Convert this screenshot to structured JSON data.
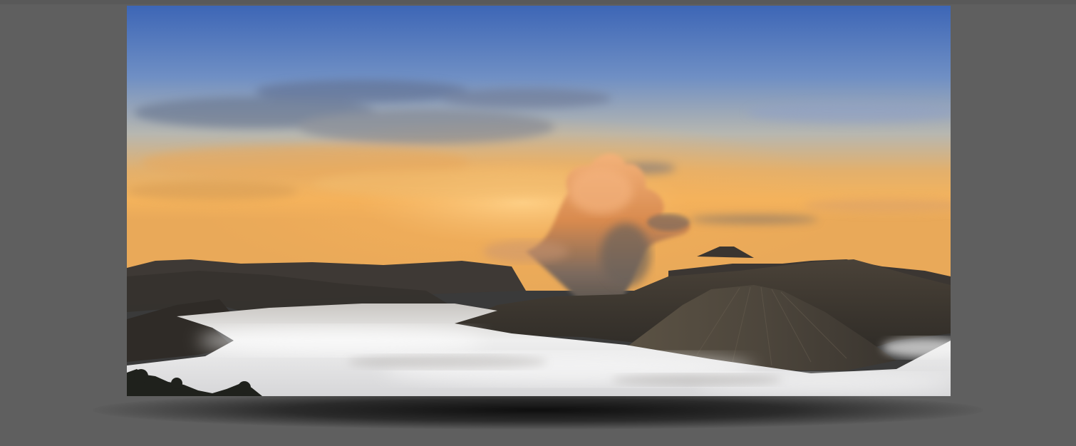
{
  "scene": {
    "subject": "volcano-landscape-photo",
    "colors": {
      "page_background": "#5f5f5f",
      "sky_top": "#3f68b8",
      "sky_mid": "#9aa9b8",
      "horizon_glow": "#f2b461",
      "plume": "#e8a05c",
      "sea_of_clouds": "#e6e6e6",
      "mountains": "#3b3733"
    }
  }
}
